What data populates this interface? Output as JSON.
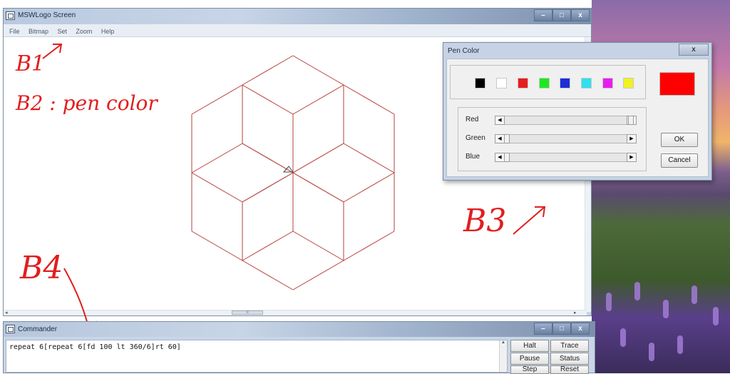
{
  "main_window": {
    "title": "MSWLogo Screen",
    "menu": [
      "File",
      "Bitmap",
      "Set",
      "Zoom",
      "Help"
    ]
  },
  "annotations": {
    "b1": "B1",
    "b2": "B2 : pen color",
    "b3": "B3",
    "b4": "B4"
  },
  "pen_dialog": {
    "title": "Pen Color",
    "close": "x",
    "swatches": [
      "#000000",
      "#ffffff",
      "#e81c1c",
      "#1ee81e",
      "#1a2fd6",
      "#2ee0f0",
      "#e81cf0",
      "#f2f21e"
    ],
    "sliders": [
      {
        "label": "Red"
      },
      {
        "label": "Green"
      },
      {
        "label": "Blue"
      }
    ],
    "preview_color": "#ff0000",
    "ok": "OK",
    "cancel": "Cancel"
  },
  "commander": {
    "title": "Commander",
    "command": "repeat 6[repeat 6[fd 100 lt 360/6]rt 60]",
    "buttons": {
      "halt": "Halt",
      "trace": "Trace",
      "pause": "Pause",
      "status": "Status",
      "step": "Step",
      "reset": "Reset"
    }
  },
  "window_controls": {
    "minimize": "–",
    "maximize": "□",
    "close": "x"
  },
  "colors": {
    "drawing_line": "#b5403c",
    "annotation": "#e01e1e"
  }
}
